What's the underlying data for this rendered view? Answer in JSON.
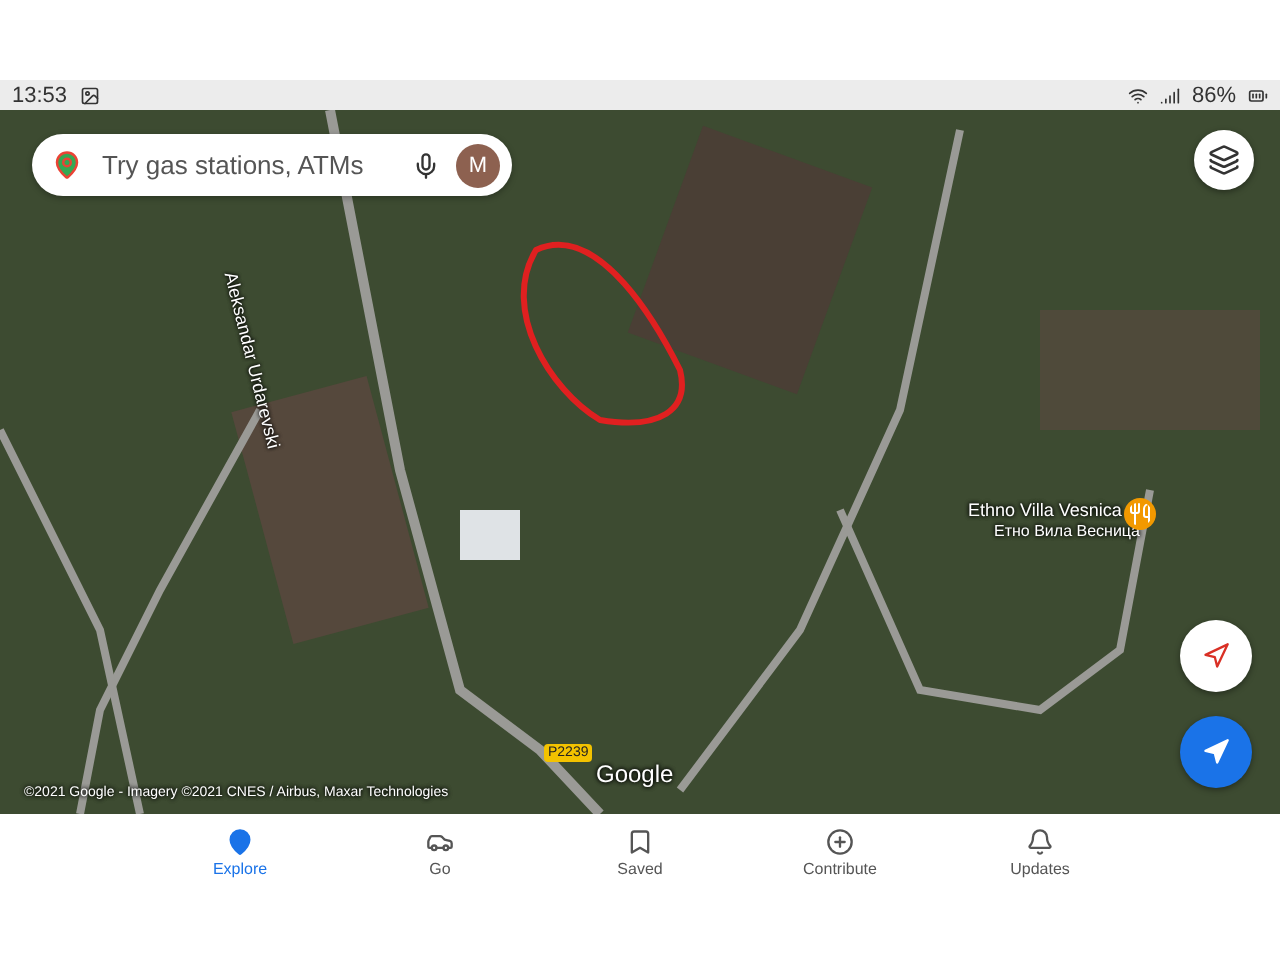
{
  "status_bar": {
    "time": "13:53",
    "battery": "86%"
  },
  "search": {
    "placeholder": "Try gas stations, ATMs",
    "avatar": "M"
  },
  "map": {
    "street_label": "Aleksandar Urdarevski",
    "road_badge": "P2239",
    "place": {
      "name": "Ethno Villa Vesnica",
      "name_local": "Етно Вила Весница"
    },
    "logo": "Google",
    "attribution": "©2021 Google - Imagery ©2021 CNES / Airbus, Maxar Technologies"
  },
  "nav": [
    {
      "kind": "explore",
      "label": "Explore",
      "selected": true
    },
    {
      "kind": "go",
      "label": "Go",
      "selected": false
    },
    {
      "kind": "saved",
      "label": "Saved",
      "selected": false
    },
    {
      "kind": "contribute",
      "label": "Contribute",
      "selected": false
    },
    {
      "kind": "updates",
      "label": "Updates",
      "selected": false
    }
  ]
}
